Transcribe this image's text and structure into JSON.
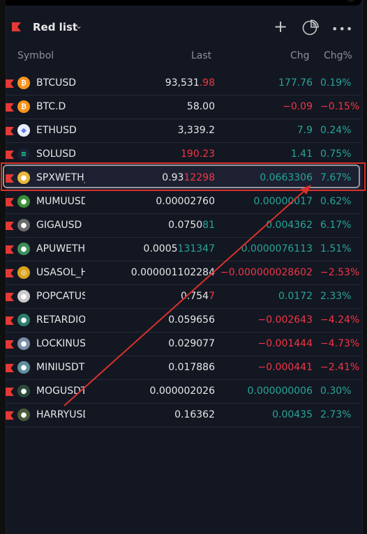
{
  "header": {
    "list_title": "Red list",
    "icons": [
      "flag-icon",
      "chevron-down-icon",
      "plus-icon",
      "pie-chart-icon",
      "more-icon"
    ]
  },
  "columns": {
    "symbol": "Symbol",
    "last": "Last",
    "chg": "Chg",
    "chgp": "Chg%"
  },
  "colors": {
    "positive": "#26a69a",
    "negative": "#f23645",
    "flag": "#e53935",
    "annotation": "#d9312b"
  },
  "rows": [
    {
      "symbol": "BTCUSD",
      "last_main": "93,531",
      "last_tail": ".98",
      "tail": "red",
      "chg": "177.76",
      "chgp": "0.19%",
      "dir": "pos",
      "icon": "bitcoin-icon"
    },
    {
      "symbol": "BTC.D",
      "last_main": "58.00",
      "last_tail": "",
      "tail": "",
      "chg": "−0.09",
      "chgp": "−0.15%",
      "dir": "neg",
      "icon": "bitcoin-icon"
    },
    {
      "symbol": "ETHUSD",
      "last_main": "3,339.2",
      "last_tail": "",
      "tail": "",
      "chg": "7.9",
      "chgp": "0.24%",
      "dir": "pos",
      "icon": "ethereum-icon"
    },
    {
      "symbol": "SOLUSD",
      "last_main": "",
      "last_tail": "190.23",
      "tail": "red",
      "chg": "1.41",
      "chgp": "0.75%",
      "dir": "pos",
      "icon": "solana-icon"
    },
    {
      "symbol": "SPXWETH_",
      "last_main": "0.93",
      "last_tail": "12298",
      "tail": "red",
      "chg": "0.0663306",
      "chgp": "7.67%",
      "dir": "pos",
      "icon": "spx-coin-icon"
    },
    {
      "symbol": "MUMUUSD",
      "last_main": "0.00002760",
      "last_tail": "",
      "tail": "",
      "chg": "0.00000017",
      "chgp": "0.62%",
      "dir": "pos",
      "icon": "mumu-coin-icon"
    },
    {
      "symbol": "GIGAUSD",
      "last_main": "0.0750",
      "last_tail": "81",
      "tail": "green",
      "chg": "0.004362",
      "chgp": "6.17%",
      "dir": "pos",
      "icon": "giga-coin-icon"
    },
    {
      "symbol": "APUWETH",
      "last_main": "0.0005",
      "last_tail": "131347",
      "tail": "green",
      "chg": "0.0000076113",
      "chgp": "1.51%",
      "dir": "pos",
      "icon": "apu-coin-icon"
    },
    {
      "symbol": "USASOL_H",
      "last_main": "0.000001102284",
      "last_tail": "",
      "tail": "",
      "chg": "−0.000000028602",
      "chgp": "−2.53%",
      "dir": "neg",
      "icon": "usasol-coin-icon"
    },
    {
      "symbol": "POPCATUS",
      "last_main": "0.754",
      "last_tail": "7",
      "tail": "red",
      "chg": "0.0172",
      "chgp": "2.33%",
      "dir": "pos",
      "icon": "popcat-coin-icon"
    },
    {
      "symbol": "RETARDIO",
      "last_main": "0.059656",
      "last_tail": "",
      "tail": "",
      "chg": "−0.002643",
      "chgp": "−4.24%",
      "dir": "neg",
      "icon": "retardio-coin-icon"
    },
    {
      "symbol": "LOCKINUS",
      "last_main": "0.029077",
      "last_tail": "",
      "tail": "",
      "chg": "−0.001444",
      "chgp": "−4.73%",
      "dir": "neg",
      "icon": "lockin-coin-icon"
    },
    {
      "symbol": "MINIUSDT",
      "last_main": "0.017886",
      "last_tail": "",
      "tail": "",
      "chg": "−0.000441",
      "chgp": "−2.41%",
      "dir": "neg",
      "icon": "mini-coin-icon"
    },
    {
      "symbol": "MOGUSDT",
      "last_main": "0.000002026",
      "last_tail": "",
      "tail": "",
      "chg": "0.000000006",
      "chgp": "0.30%",
      "dir": "pos",
      "icon": "mog-coin-icon"
    },
    {
      "symbol": "HARRYUSD",
      "last_main": "0.16362",
      "last_tail": "",
      "tail": "",
      "chg": "0.00435",
      "chgp": "2.73%",
      "dir": "pos",
      "icon": "harry-coin-icon"
    }
  ]
}
